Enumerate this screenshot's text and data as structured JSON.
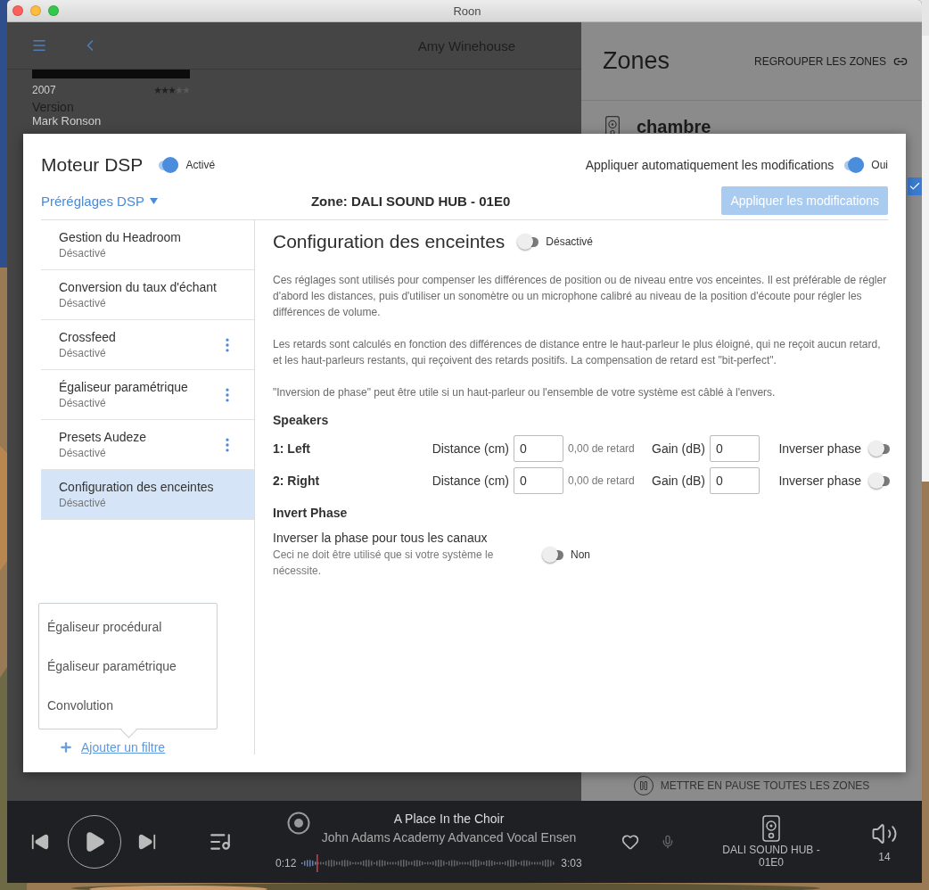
{
  "window": {
    "title": "Roon"
  },
  "background": {
    "header_title": "Amy Winehouse",
    "album": {
      "year": "2007",
      "stars": 3,
      "title": "Version",
      "artist": "Mark Ronson"
    },
    "zones": {
      "title": "Zones",
      "group_button": "REGROUPER LES ZONES",
      "zone_name": "chambre",
      "zone_selected": true,
      "pause_all": "METTRE EN PAUSE TOUTES LES ZONES"
    }
  },
  "dsp": {
    "title": "Moteur DSP",
    "enabled": true,
    "enabled_label": "Activé",
    "presets": "Préréglages DSP",
    "zone_label": "Zone: DALI SOUND HUB - 01E0",
    "auto_apply_label": "Appliquer automatiquement les modifications",
    "auto_apply": true,
    "auto_apply_value": "Oui",
    "apply_button": {
      "label": "Appliquer les modifications",
      "disabled": true
    }
  },
  "filters": [
    {
      "name": "Gestion du Headroom",
      "status": "Désactivé",
      "has_menu": false,
      "selected": false
    },
    {
      "name": "Conversion du taux d'échant",
      "status": "Désactivé",
      "has_menu": false,
      "selected": false
    },
    {
      "name": "Crossfeed",
      "status": "Désactivé",
      "has_menu": true,
      "selected": false
    },
    {
      "name": "Égaliseur paramétrique",
      "status": "Désactivé",
      "has_menu": true,
      "selected": false
    },
    {
      "name": "Presets Audeze",
      "status": "Désactivé",
      "has_menu": true,
      "selected": false
    },
    {
      "name": "Configuration des enceintes",
      "status": "Désactivé",
      "has_menu": false,
      "selected": true
    }
  ],
  "add_menu": {
    "items": [
      "Égaliseur procédural",
      "Égaliseur paramétrique",
      "Convolution"
    ],
    "add_label": "Ajouter un filtre"
  },
  "detail": {
    "title": "Configuration des enceintes",
    "enabled": false,
    "status_label": "Désactivé",
    "paragraphs": [
      "Ces réglages sont utilisés pour compenser les différences de position ou de niveau entre vos enceintes. Il est préférable de régler d'abord les distances, puis d'utiliser un sonomètre ou un microphone calibré au niveau de la position d'écoute pour régler les différences de volume.",
      "Les retards sont calculés en fonction des différences de distance entre le haut-parleur le plus éloigné, qui ne reçoit aucun retard, et les haut-parleurs restants, qui reçoivent des retards positifs. La compensation de retard est \"bit-perfect\".",
      "\"Inversion de phase\" peut être utile si un haut-parleur ou l'ensemble de votre système est câblé à l'envers."
    ],
    "speakers_heading": "Speakers",
    "speakers": [
      {
        "name": "1: Left",
        "distance_label": "Distance (cm)",
        "distance": "0",
        "delay": "0,00 de retard",
        "gain_label": "Gain (dB)",
        "gain": "0",
        "invert_label": "Inverser phase",
        "invert": false
      },
      {
        "name": "2: Right",
        "distance_label": "Distance (cm)",
        "distance": "0",
        "delay": "0,00 de retard",
        "gain_label": "Gain (dB)",
        "gain": "0",
        "invert_label": "Inverser phase",
        "invert": false
      }
    ],
    "invert_heading": "Invert Phase",
    "invert_all": {
      "label": "Inverser la phase pour tous les canaux",
      "hint": "Ceci ne doit être utilisé que si votre système le nécessite.",
      "on": false,
      "value_label": "Non"
    }
  },
  "player": {
    "track": "A Place In the Choir",
    "artist": "John Adams Academy Advanced Vocal Ensen",
    "elapsed": "0:12",
    "duration": "3:03",
    "level": 0.06,
    "zone": "DALI SOUND HUB - 01E0",
    "volume": "14"
  }
}
